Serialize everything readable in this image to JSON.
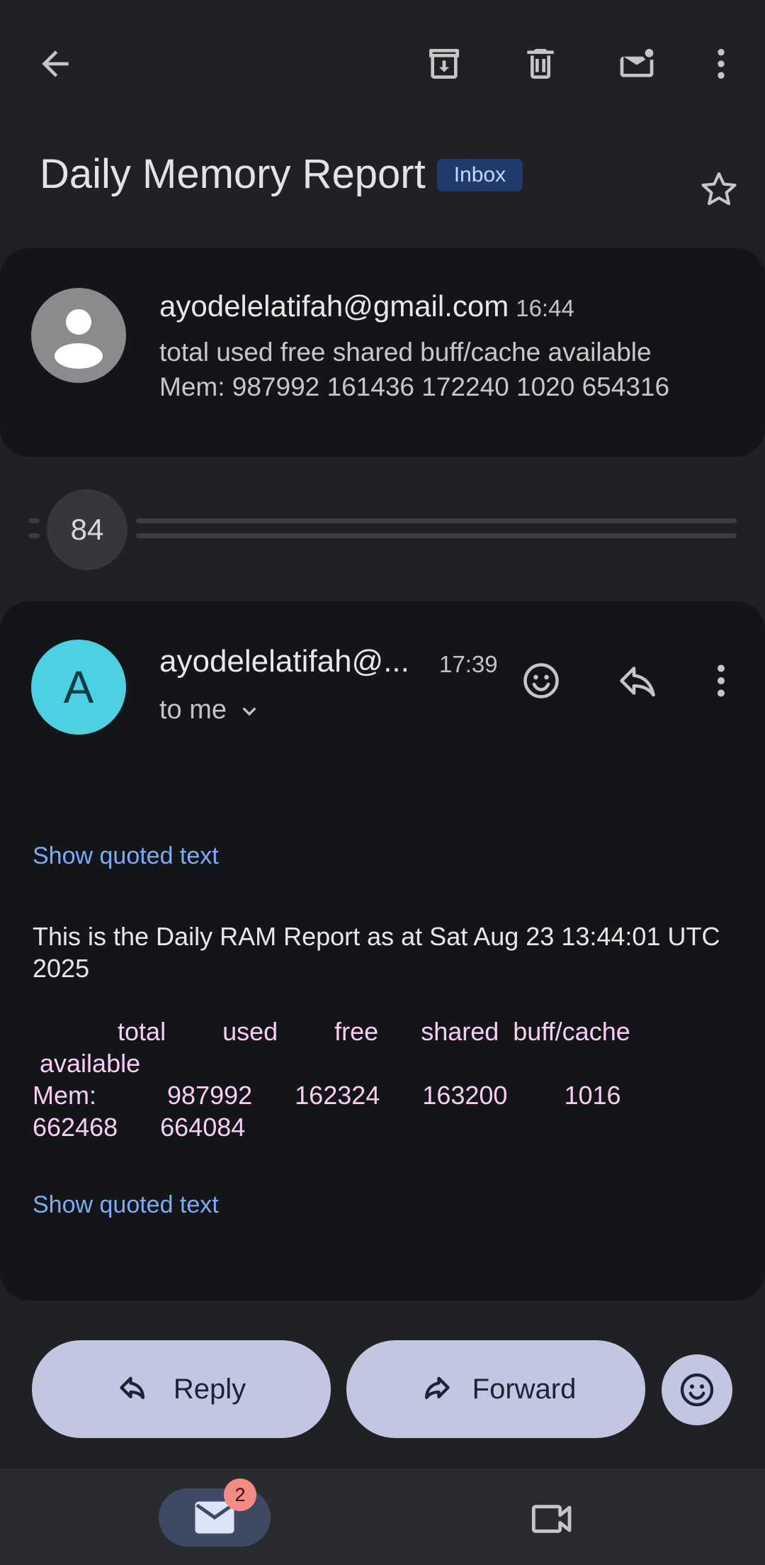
{
  "subject": "Daily Memory Report",
  "label": "Inbox",
  "collapsed_message": {
    "sender": "ayodelelatifah@gmail.com",
    "time": "16:44",
    "snippet_line1": "total used free shared buff/cache available",
    "snippet_line2": "Mem: 987992 161436 172240 1020 654316"
  },
  "hidden_count": "84",
  "open_message": {
    "avatar_letter": "A",
    "sender": "ayodelelatifah@...",
    "time": "17:39",
    "recipient": "to me",
    "show_quoted_1": "Show quoted text",
    "body": "This is the Daily RAM Report as at Sat Aug 23 13:44:01 UTC 2025",
    "table": "            total        used        free      shared  buff/cache\n available\nMem:          987992      162324      163200        1016\n662468      664084",
    "show_quoted_2": "Show quoted text"
  },
  "actions": {
    "reply": "Reply",
    "forward": "Forward"
  },
  "nav": {
    "mail_badge": "2"
  },
  "icons": {
    "back": "arrow-back-icon",
    "archive": "archive-icon",
    "delete": "trash-icon",
    "unread": "mark-unread-icon",
    "more": "more-vert-icon",
    "star": "star-icon",
    "emoji": "emoji-icon",
    "reply": "reply-icon",
    "forward": "forward-icon",
    "mail": "mail-icon",
    "meet": "video-icon"
  },
  "colors": {
    "background": "#202124",
    "card": "#141518",
    "link": "#7cacf8",
    "pink_text": "#f9cdf5",
    "avatar_cyan": "#4dd0e1",
    "button": "#c2c6e0",
    "badge": "#f28b82",
    "chip": "#1f3b6b"
  }
}
